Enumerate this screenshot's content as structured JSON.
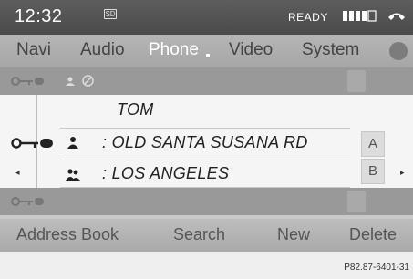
{
  "status_bar": {
    "time": "12:32",
    "sd_icon_label": "SD",
    "ready_label": "READY",
    "signal_icon": "signal-bars-icon",
    "handset_icon": "handset-icon"
  },
  "nav_tabs": [
    {
      "label": "Navi",
      "active": false
    },
    {
      "label": "Audio",
      "active": false
    },
    {
      "label": "Phone",
      "active": true
    },
    {
      "label": "Video",
      "active": false
    },
    {
      "label": "System",
      "active": false
    }
  ],
  "contact": {
    "name": "TOM",
    "street": ": OLD SANTA SUSANA RD",
    "city": ": LOS ANGELES"
  },
  "alpha_index": [
    {
      "letter": "A"
    },
    {
      "letter": "B"
    }
  ],
  "softkeys": [
    {
      "label": "Address Book"
    },
    {
      "label": "Search"
    },
    {
      "label": "New"
    },
    {
      "label": "Delete"
    }
  ],
  "figure_ref": "P82.87-6401-31",
  "colors": {
    "status_bg": "#505050",
    "tabs_bg": "#ababab",
    "active_tab_text": "#ffffff",
    "list_bg": "#f5f5f5",
    "dim_row_bg": "#999999"
  }
}
